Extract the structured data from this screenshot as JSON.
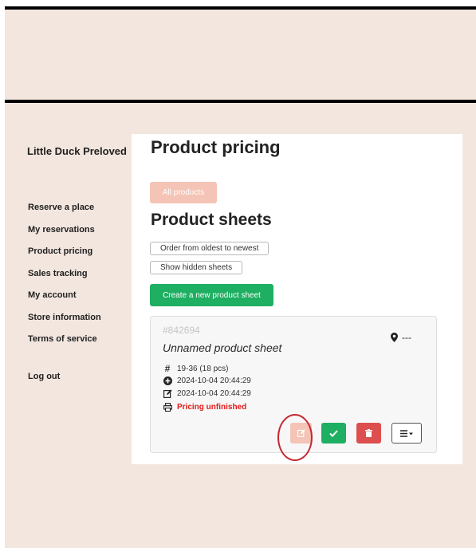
{
  "sidebar": {
    "brand": "Little Duck Preloved",
    "items": [
      {
        "label": "Reserve a place"
      },
      {
        "label": "My reservations"
      },
      {
        "label": "Product pricing"
      },
      {
        "label": "Sales tracking"
      },
      {
        "label": "My account"
      },
      {
        "label": "Store information"
      },
      {
        "label": "Terms of service"
      }
    ],
    "logout": "Log out"
  },
  "main": {
    "title": "Product pricing",
    "all_products_label": "All products",
    "sheets_title": "Product sheets",
    "order_label": "Order from oldest to newest",
    "hidden_label": "Show hidden sheets",
    "create_label": "Create a new product sheet"
  },
  "card": {
    "id": "#842694",
    "name": "Unnamed product sheet",
    "location": "---",
    "range": "19-36 (18 pcs)",
    "created": "2024-10-04 20:44:29",
    "modified": "2024-10-04 20:44:29",
    "status": "Pricing unfinished"
  },
  "icons": {
    "location": "map-pin-icon",
    "range": "hash-icon",
    "created": "plus-circle-icon",
    "modified": "edit-icon",
    "status": "printer-icon",
    "edit": "edit-icon",
    "approve": "check-icon",
    "delete": "trash-icon",
    "menu": "menu-dropdown-icon"
  },
  "colors": {
    "background": "#f2e6df",
    "accent_peach": "#f4c4b6",
    "success": "#1eaf62",
    "danger": "#dd4e4e",
    "status_red": "#e21919",
    "highlight_ring": "#c42833"
  }
}
